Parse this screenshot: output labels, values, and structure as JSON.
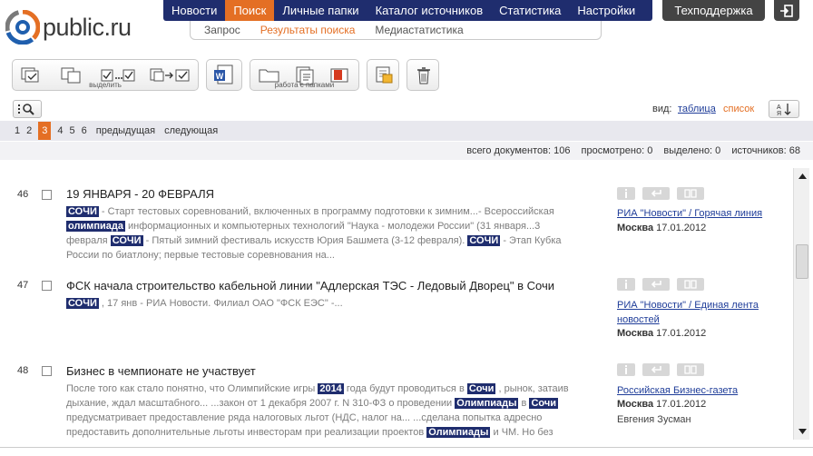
{
  "logo": {
    "text": "public.ru"
  },
  "nav": {
    "items": [
      {
        "label": "Новости"
      },
      {
        "label": "Поиск"
      },
      {
        "label": "Личные папки"
      },
      {
        "label": "Каталог источников"
      },
      {
        "label": "Статистика"
      },
      {
        "label": "Настройки"
      }
    ],
    "active": "Поиск"
  },
  "subnav": {
    "items": [
      {
        "label": "Запрос"
      },
      {
        "label": "Результаты поиска"
      },
      {
        "label": "Медиастатистика"
      }
    ],
    "active": "Результаты поиска"
  },
  "support": {
    "label": "Техподдержка"
  },
  "toolbar": {
    "select_caption": "выделить",
    "folders_caption": "работа с папками"
  },
  "view": {
    "label": "вид:",
    "table": "таблица",
    "list": "список"
  },
  "pager": {
    "pages": [
      "1",
      "2",
      "3",
      "4",
      "5",
      "6"
    ],
    "current": "3",
    "prev": "предыдущая",
    "next": "следующая"
  },
  "stats": {
    "total": "всего документов: 106",
    "viewed": "просмотрено: 0",
    "selected": "выделено: 0",
    "sources": "источников: 68"
  },
  "results": [
    {
      "num": "46",
      "title": "19 ЯНВАРЯ - 20 ФЕВРАЛЯ",
      "source": "РИА \"Новости\" / Горячая линия",
      "city": "Москва",
      "date": "17.01.2012",
      "author": ""
    },
    {
      "num": "47",
      "title": "ФСК начала строительство кабельной линии \"Адлерская ТЭС - Ледовый Дворец\" в Сочи",
      "source": "РИА \"Новости\" / Единая лента новостей",
      "city": "Москва",
      "date": "17.01.2012",
      "author": ""
    },
    {
      "num": "48",
      "title": "Бизнес в чемпионате не участвует",
      "source": "Российская Бизнес-газета",
      "city": "Москва",
      "date": "17.01.2012",
      "author": "Евгения Зусман"
    }
  ],
  "snippets": {
    "r46": {
      "a": "СОЧИ",
      "b": " - Старт тестовых соревнований, включенных в программу подготовки к зимним...- Всероссийская ",
      "c": "олимпиада",
      "d": " информационных и компьютерных технологий \"Наука - молодежи России\" (31 января...3 февраля ",
      "e": "СОЧИ",
      "f": " - Пятый зимний фестиваль искусств Юрия Башмета (3-12 февраля). ",
      "g": "СОЧИ",
      "h": " - Этап Кубка России по биатлону; первые тестовые соревнования на..."
    },
    "r47": {
      "a": "СОЧИ",
      "b": " , 17 янв - РИА Новости. Филиал ОАО \"ФСК ЕЭС\" -..."
    },
    "r48": {
      "a": "После того как стало понятно, что Олимпийские игры ",
      "b": "2014",
      "c": " года будут проводиться в ",
      "d": "Сочи",
      "e": " , рынок, затаив дыхание, ждал масштабного... ...закон от 1 декабря 2007 г. N 310-ФЗ о проведении ",
      "f": "Олимпиады",
      "g": " в ",
      "h": "Сочи",
      "i": " предусматривает предоставление ряда налоговых льгот (НДС, налог на... ...сделана попытка адресно предоставить дополнительные льготы инвесторам при реализации проектов ",
      "j": "Олимпиады",
      "k": " и ЧМ. Но без конкретных механизмов и гарантий со стороны..."
    }
  },
  "colors": {
    "nav_bg": "#1f2d6e",
    "accent": "#e46f24",
    "link": "#1f3d99",
    "highlight_bg": "#1f2d6e"
  }
}
